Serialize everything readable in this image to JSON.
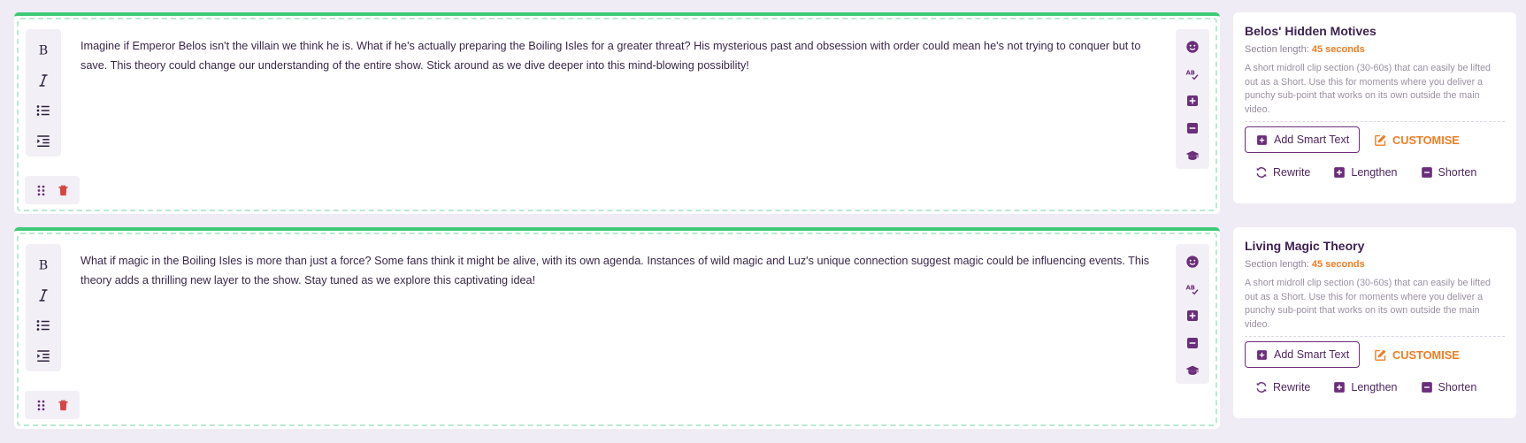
{
  "colors": {
    "accent_purple": "#6b2e7a",
    "accent_green": "#3ec978",
    "accent_orange": "#f07d22",
    "delete_red": "#d64545"
  },
  "sections": [
    {
      "text": "Imagine if Emperor Belos isn't the villain we think he is. What if he's actually preparing the Boiling Isles for a greater threat? His mysterious past and obsession with order could mean he's not trying to conquer but to save. This theory could change our understanding of the entire show. Stick around as we dive deeper into this mind-blowing possibility!",
      "card": {
        "title": "Belos' Hidden Motives",
        "length_label": "Section length:",
        "length_value": "45 seconds",
        "description": "A short midroll clip section (30-60s) that can easily be lifted out as a Short. Use this for moments where you deliver a punchy sub-point that works on its own outside the main video.",
        "add_smart_text": "Add Smart Text",
        "customise": "CUSTOMISE",
        "rewrite": "Rewrite",
        "lengthen": "Lengthen",
        "shorten": "Shorten"
      }
    },
    {
      "text": "What if magic in the Boiling Isles is more than just a force? Some fans think it might be alive, with its own agenda. Instances of wild magic and Luz's unique connection suggest magic could be influencing events. This theory adds a thrilling new layer to the show. Stay tuned as we explore this captivating idea!",
      "card": {
        "title": "Living Magic Theory",
        "length_label": "Section length:",
        "length_value": "45 seconds",
        "description": "A short midroll clip section (30-60s) that can easily be lifted out as a Short. Use this for moments where you deliver a punchy sub-point that works on its own outside the main video.",
        "add_smart_text": "Add Smart Text",
        "customise": "CUSTOMISE",
        "rewrite": "Rewrite",
        "lengthen": "Lengthen",
        "shorten": "Shorten"
      }
    }
  ],
  "icons": {
    "format_toolbar": [
      "bold-icon",
      "italic-icon",
      "bullet-list-icon",
      "indent-icon"
    ],
    "bottom_toolbar": [
      "drag-handle-icon",
      "trash-icon"
    ],
    "tools_toolbar": [
      "emoji-icon",
      "spellcheck-icon",
      "plus-square-icon",
      "minus-square-icon",
      "graduation-cap-icon"
    ]
  }
}
